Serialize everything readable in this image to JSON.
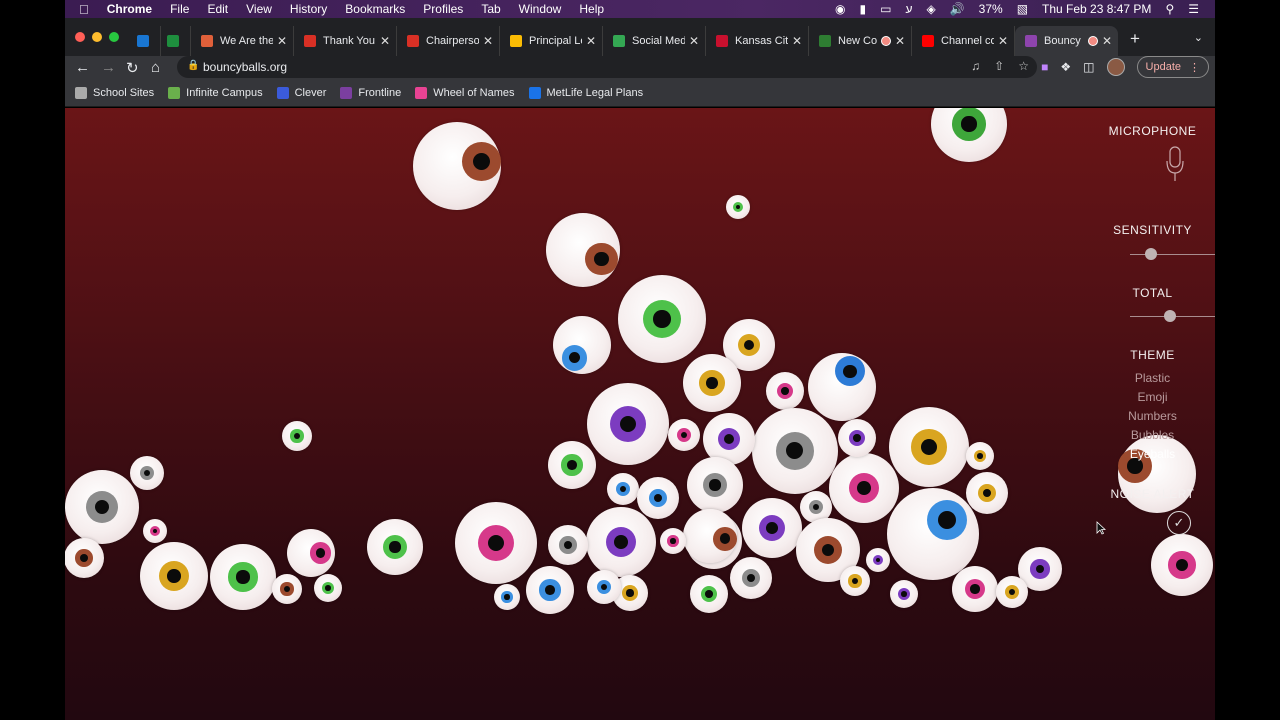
{
  "menubar": {
    "apple": "",
    "app": "Chrome",
    "menus": [
      "File",
      "Edit",
      "View",
      "History",
      "Bookmarks",
      "Profiles",
      "Tab",
      "Window",
      "Help"
    ],
    "battery": "37%",
    "datetime": "Thu Feb 23  8:47 PM"
  },
  "tabs": [
    {
      "label": "",
      "icon": "outlook-icon",
      "color": "#1976d2"
    },
    {
      "label": "",
      "icon": "sheets-icon",
      "color": "#1e8e3e"
    },
    {
      "label": "We Are the",
      "icon": "firework-icon",
      "color": "#e0603a"
    },
    {
      "label": "Thank You",
      "icon": "s-icon",
      "color": "#d93025"
    },
    {
      "label": "Chairperso",
      "icon": "s-icon",
      "color": "#d93025"
    },
    {
      "label": "Principal Le",
      "icon": "drive-icon",
      "color": "#fbbc04"
    },
    {
      "label": "Social Med",
      "icon": "drive-icon",
      "color": "#34a853"
    },
    {
      "label": "Kansas City",
      "icon": "chiefs-icon",
      "color": "#c8102e"
    },
    {
      "label": "New Co",
      "icon": "classroom-icon",
      "color": "#2e7d32"
    },
    {
      "label": "Channel co",
      "icon": "youtube-icon",
      "color": "#ff0000"
    },
    {
      "label": "Bouncy",
      "icon": "bouncy-icon",
      "color": "#8e44ad"
    }
  ],
  "address": {
    "url": "bouncyballs.org"
  },
  "update_label": "Update",
  "bookmarks": [
    {
      "label": "School Sites",
      "icon": "folder-icon",
      "color": "#aaaaaa"
    },
    {
      "label": "Infinite Campus",
      "icon": "campus-icon",
      "color": "#6ab04c"
    },
    {
      "label": "Clever",
      "icon": "clever-icon",
      "color": "#3b5bdb"
    },
    {
      "label": "Frontline",
      "icon": "frontline-icon",
      "color": "#7b3fa0"
    },
    {
      "label": "Wheel of Names",
      "icon": "wheel-icon",
      "color": "#e84393"
    },
    {
      "label": "MetLife Legal Plans",
      "icon": "metlife-icon",
      "color": "#1a73e8"
    }
  ],
  "sidebar": {
    "microphone": "MICROPHONE",
    "sensitivity": "SENSITIVITY",
    "sensitivity_value": 0.22,
    "total": "TOTAL",
    "total_value": 0.42,
    "theme": "THEME",
    "theme_options": [
      "Plastic",
      "Emoji",
      "Numbers",
      "Bubbles",
      "Eyeballs"
    ],
    "theme_selected": "Eyeballs",
    "noise_alert": "NOISE ALERT"
  },
  "eyeballs": [
    {
      "iris": "#9c4a2e"
    },
    {
      "iris": "#3ea63a"
    },
    {
      "iris": "#4ec14a"
    },
    {
      "iris": "#9c4a2e"
    },
    {
      "iris": "#4ec14a"
    },
    {
      "iris": "#3b8fe0"
    },
    {
      "iris": "#d9a520"
    },
    {
      "iris": "#d9a520"
    },
    {
      "iris": "#d6398a"
    },
    {
      "iris": "#2d7bd6"
    },
    {
      "iris": "#7c3cc0"
    },
    {
      "iris": "#8c8c8c"
    },
    {
      "iris": "#d9a520"
    },
    {
      "iris": "#4ec14a"
    },
    {
      "iris": "#7c3cc0"
    },
    {
      "iris": "#d6398a"
    },
    {
      "iris": "#d6398a"
    },
    {
      "iris": "#3b8fe0"
    },
    {
      "iris": "#7c3cc0"
    },
    {
      "iris": "#8c8c8c"
    },
    {
      "iris": "#d9a520"
    },
    {
      "iris": "#3b8fe0"
    },
    {
      "iris": "#8c8c8c"
    },
    {
      "iris": "#8c8c8c"
    },
    {
      "iris": "#d9a520"
    },
    {
      "iris": "#4ec14a"
    },
    {
      "iris": "#d6398a"
    },
    {
      "iris": "#9c4a2e"
    },
    {
      "iris": "#4ec14a"
    },
    {
      "iris": "#d6398a"
    },
    {
      "iris": "#7c3cc0"
    },
    {
      "iris": "#9c4a2e"
    },
    {
      "iris": "#7c3cc0"
    },
    {
      "iris": "#9c4a2e"
    },
    {
      "iris": "#d6398a"
    },
    {
      "iris": "#3b8fe0"
    },
    {
      "iris": "#7c3cc0"
    },
    {
      "iris": "#8c8c8c"
    },
    {
      "iris": "#d6398a"
    },
    {
      "iris": "#7c3cc0"
    },
    {
      "iris": "#8c8c8c"
    },
    {
      "iris": "#d6398a"
    },
    {
      "iris": "#d9a520"
    },
    {
      "iris": "#4ec14a"
    },
    {
      "iris": "#d6398a"
    },
    {
      "iris": "#3b8fe0"
    },
    {
      "iris": "#d9a520"
    },
    {
      "iris": "#9c4a2e"
    },
    {
      "iris": "#4ec14a"
    },
    {
      "iris": "#3b8fe0"
    },
    {
      "iris": "#d9a520"
    },
    {
      "iris": "#9c4a2e"
    },
    {
      "iris": "#d6398a"
    },
    {
      "iris": "#7c3cc0"
    },
    {
      "iris": "#4ec14a"
    },
    {
      "iris": "#8c8c8c"
    },
    {
      "iris": "#3b8fe0"
    },
    {
      "iris": "#d9a520"
    }
  ]
}
